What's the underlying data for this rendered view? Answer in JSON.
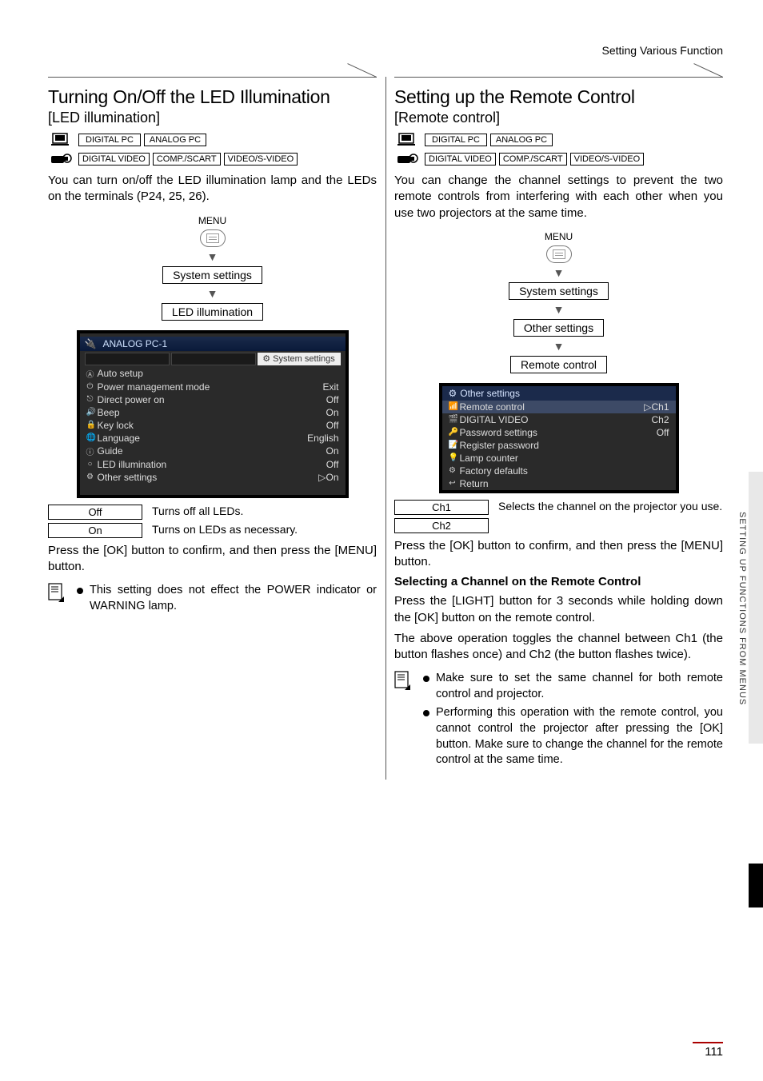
{
  "header": "Setting Various Function",
  "left": {
    "title": "Turning On/Off the LED Illumination",
    "subtitle": "[LED illumination]",
    "sources_row1": [
      "DIGITAL PC",
      "ANALOG PC"
    ],
    "sources_row2": [
      "DIGITAL VIDEO",
      "COMP./SCART",
      "VIDEO/S-VIDEO"
    ],
    "intro": "You can turn on/off the LED illumination lamp and the LEDs on the terminals (P24, 25, 26).",
    "flow": {
      "menu": "MENU",
      "step1": "System settings",
      "step2": "LED illumination"
    },
    "osd": {
      "header": "ANALOG PC-1",
      "tab_sel": "System settings",
      "rows": [
        {
          "icon": "Ⓐ",
          "label": "Auto setup",
          "value": ""
        },
        {
          "icon": "⏻",
          "label": "Power management mode",
          "value": "Exit"
        },
        {
          "icon": "⎋",
          "label": "Direct power on",
          "value": "Off"
        },
        {
          "icon": "🔊",
          "label": "Beep",
          "value": "On"
        },
        {
          "icon": "🔒",
          "label": "Key lock",
          "value": "Off"
        },
        {
          "icon": "🌐",
          "label": "Language",
          "value": "English"
        },
        {
          "icon": "ⓘ",
          "label": "Guide",
          "value": "On"
        },
        {
          "icon": "○",
          "label": "LED illumination",
          "value": "Off"
        },
        {
          "icon": "⚙",
          "label": "Other settings",
          "value": "▷On"
        }
      ]
    },
    "options": [
      {
        "label": "Off",
        "text": "Turns off all LEDs."
      },
      {
        "label": "On",
        "text": "Turns on LEDs as necessary."
      }
    ],
    "press_ok": "Press the [OK] button to confirm, and then press the [MENU] button.",
    "note": "This setting does not effect the POWER indicator or WARNING lamp."
  },
  "right": {
    "title": "Setting up the Remote Control",
    "subtitle": "[Remote control]",
    "sources_row1": [
      "DIGITAL PC",
      "ANALOG PC"
    ],
    "sources_row2": [
      "DIGITAL VIDEO",
      "COMP./SCART",
      "VIDEO/S-VIDEO"
    ],
    "intro": "You can change the channel settings to prevent the two remote controls from interfering with each other when you use two projectors at the same time.",
    "flow": {
      "menu": "MENU",
      "step1": "System settings",
      "step2": "Other settings",
      "step3": "Remote control"
    },
    "osd": {
      "title": "Other settings",
      "rows": [
        {
          "icon": "📶",
          "label": "Remote control",
          "value": "▷Ch1",
          "hl": true
        },
        {
          "icon": "🎬",
          "label": "DIGITAL VIDEO",
          "value": "Ch2"
        },
        {
          "icon": "🔑",
          "label": "Password settings",
          "value": "Off"
        },
        {
          "icon": "📝",
          "label": "Register password",
          "value": ""
        },
        {
          "icon": "💡",
          "label": "Lamp counter",
          "value": ""
        },
        {
          "icon": "⚙",
          "label": "Factory defaults",
          "value": ""
        },
        {
          "icon": "↩",
          "label": "Return",
          "value": ""
        }
      ]
    },
    "options": [
      {
        "label": "Ch1",
        "text": "Selects the channel on the projector you use."
      },
      {
        "label": "Ch2",
        "text": ""
      }
    ],
    "press_ok": "Press the [OK] button to confirm, and then press the [MENU] button.",
    "subhead": "Selecting a Channel on the Remote Control",
    "para1": "Press the [LIGHT] button for 3 seconds while holding down the [OK] button on the remote control.",
    "para2": "The above operation toggles the channel between Ch1 (the button flashes once) and Ch2 (the button flashes twice).",
    "notes": [
      "Make sure to set the same channel for both remote control and projector.",
      "Performing this operation with the remote control, you cannot control the projector after pressing the [OK] button. Make sure to change the channel for the remote control at the same time."
    ]
  },
  "side_label": "SETTING UP FUNCTIONS FROM MENUS",
  "page_number": "111"
}
